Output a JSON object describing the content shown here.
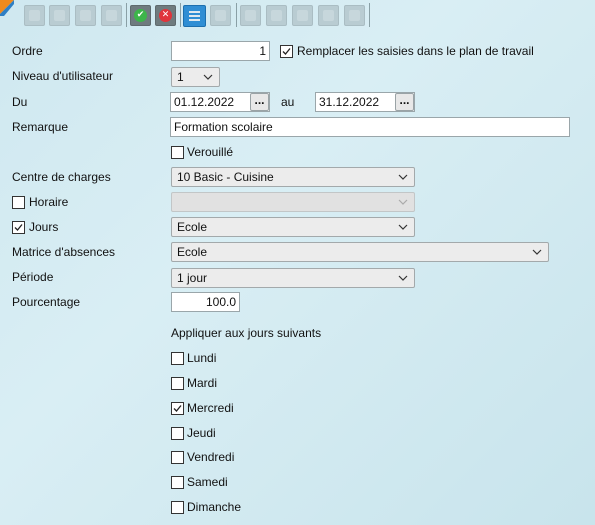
{
  "toolbar": {
    "ok_icon": "check-icon",
    "cancel_icon": "close-icon",
    "list_icon": "list-icon"
  },
  "form": {
    "ordre_label": "Ordre",
    "ordre_value": "1",
    "remplacer_label": "Remplacer les saisies dans le plan de travail",
    "remplacer_checked": true,
    "niveau_label": "Niveau d'utilisateur",
    "niveau_value": "1",
    "du_label": "Du",
    "du_value": "01.12.2022",
    "au_label": "au",
    "au_value": "31.12.2022",
    "date_button_label": "...",
    "remarque_label": "Remarque",
    "remarque_value": "Formation scolaire",
    "verouille_label": "Verouillé",
    "verouille_checked": false,
    "centre_label": "Centre de charges",
    "centre_value": "10 Basic - Cuisine",
    "horaire_label": "Horaire",
    "horaire_checked": false,
    "horaire_value": "",
    "jours_label": "Jours",
    "jours_checked": true,
    "jours_value": "Ecole",
    "matrice_label": "Matrice d'absences",
    "matrice_value": "Ecole",
    "periode_label": "Période",
    "periode_value": "1 jour",
    "pourcentage_label": "Pourcentage",
    "pourcentage_value": "100.0",
    "appliquer_label": "Appliquer aux jours suivants"
  },
  "days": [
    {
      "label": "Lundi",
      "checked": false
    },
    {
      "label": "Mardi",
      "checked": false
    },
    {
      "label": "Mercredi",
      "checked": true
    },
    {
      "label": "Jeudi",
      "checked": false
    },
    {
      "label": "Vendredi",
      "checked": false
    },
    {
      "label": "Samedi",
      "checked": false
    },
    {
      "label": "Dimanche",
      "checked": false
    }
  ],
  "colors": {
    "background": "#d4ebf2",
    "accent": "#2f8ed4",
    "ok": "#3cb54a",
    "cancel": "#e0343c"
  }
}
